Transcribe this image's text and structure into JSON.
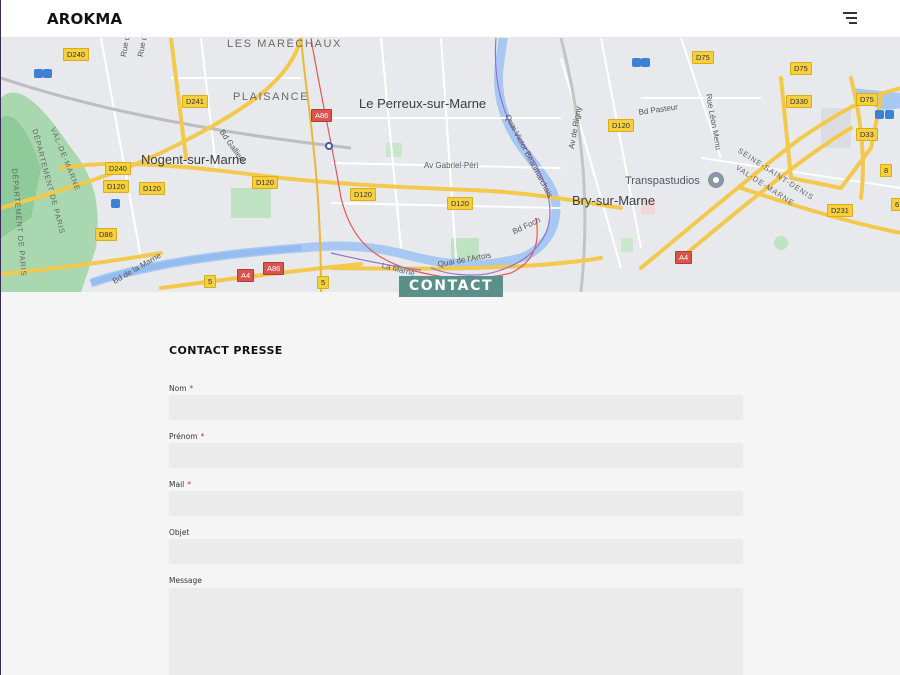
{
  "header": {
    "brand": "AROKMA",
    "menu_icon": "hamburger-menu-icon"
  },
  "map": {
    "places": {
      "les_marechaux": "LES MARÉCHAUX",
      "plaisance": "PLAISANCE",
      "le_perreux": "Le Perreux-sur-Marne",
      "nogent": "Nogent-sur-Marne",
      "bry": "Bry-sur-Marne",
      "transpastudios": "Transpastudios",
      "seine_st_denis": "SEINE-SAINT-DENIS",
      "val_de_marne_right": "VAL-DE-MARNE",
      "val_de_marne_left": "VAL-DE-MARNE",
      "dept_paris": "DÉPARTEMENT DE PARIS",
      "dept_paris_2": "DÉPARTEMENT DE PARIS"
    },
    "streets": {
      "av_gabriel_peri": "Av Gabriel-Péri",
      "la_marne": "La Marne",
      "quai_artois": "Quai de l'Artois",
      "bd_foch": "Bd Foch",
      "quai_victor": "Quai Victor Beaumarchais",
      "bd_gallieni": "Bd Gallieni",
      "rue_joinville": "Rue de Joinville",
      "rue_fontenay": "Rue de Fontenay",
      "av_rigny": "Av de Rigny",
      "bd_pasteur": "Bd Pasteur",
      "rue_leon_menu": "Rue Léon Menu",
      "bd_de_la_marne": "Bd de la Marne"
    },
    "roads": {
      "d240a": "D240",
      "d241": "D241",
      "d240b": "D240",
      "d120a": "D120",
      "d120b": "D120",
      "d120c": "D120",
      "d120d": "D120",
      "d120e": "D120",
      "d120f": "D120",
      "d86": "D86",
      "a86a": "A86",
      "a86b": "A86",
      "a4a": "A4",
      "a4b": "A4",
      "d75a": "D75",
      "d75b": "D75",
      "d75c": "D75",
      "d330": "D330",
      "d33": "D33",
      "d231": "D231",
      "r5a": "5",
      "r5b": "5",
      "r8": "8",
      "r6": "6"
    }
  },
  "banner": {
    "label": "CONTACT"
  },
  "form": {
    "title": "CONTACT PRESSE",
    "fields": [
      {
        "label": "Nom",
        "required_mark": "*"
      },
      {
        "label": "Prénom",
        "required_mark": "*"
      },
      {
        "label": "Mail",
        "required_mark": "*"
      },
      {
        "label": "Objet",
        "required_mark": ""
      },
      {
        "label": "Message",
        "required_mark": ""
      }
    ]
  }
}
